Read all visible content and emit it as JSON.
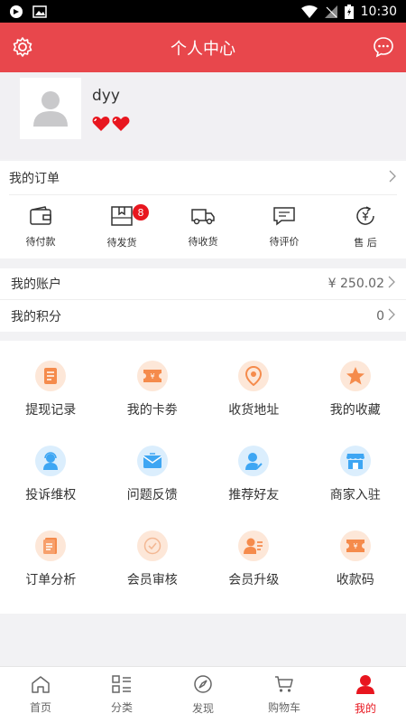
{
  "status_bar": {
    "time": "10:30"
  },
  "header": {
    "title": "个人中心"
  },
  "profile": {
    "username": "dyy"
  },
  "orders": {
    "title": "我的订单",
    "items": [
      {
        "label": "待付款"
      },
      {
        "label": "待发货",
        "badge": "8"
      },
      {
        "label": "待收货"
      },
      {
        "label": "待评价"
      },
      {
        "label": "售 后"
      }
    ]
  },
  "account": {
    "balance_label": "我的账户",
    "balance_value": "¥ 250.02",
    "points_label": "我的积分",
    "points_value": "0"
  },
  "services": [
    {
      "label": "提现记录"
    },
    {
      "label": "我的卡劵"
    },
    {
      "label": "收货地址"
    },
    {
      "label": "我的收藏"
    },
    {
      "label": "投诉维权"
    },
    {
      "label": "问题反馈"
    },
    {
      "label": "推荐好友"
    },
    {
      "label": "商家入驻"
    },
    {
      "label": "订单分析"
    },
    {
      "label": "会员审核"
    },
    {
      "label": "会员升级"
    },
    {
      "label": "收款码"
    }
  ],
  "tabs": [
    {
      "label": "首页"
    },
    {
      "label": "分类"
    },
    {
      "label": "发现"
    },
    {
      "label": "购物车"
    },
    {
      "label": "我的"
    }
  ],
  "colors": {
    "brand": "#e8474c",
    "accent_red": "#e8161f",
    "icon_orange": "#f58b4c",
    "icon_blue": "#3ea6f3"
  }
}
